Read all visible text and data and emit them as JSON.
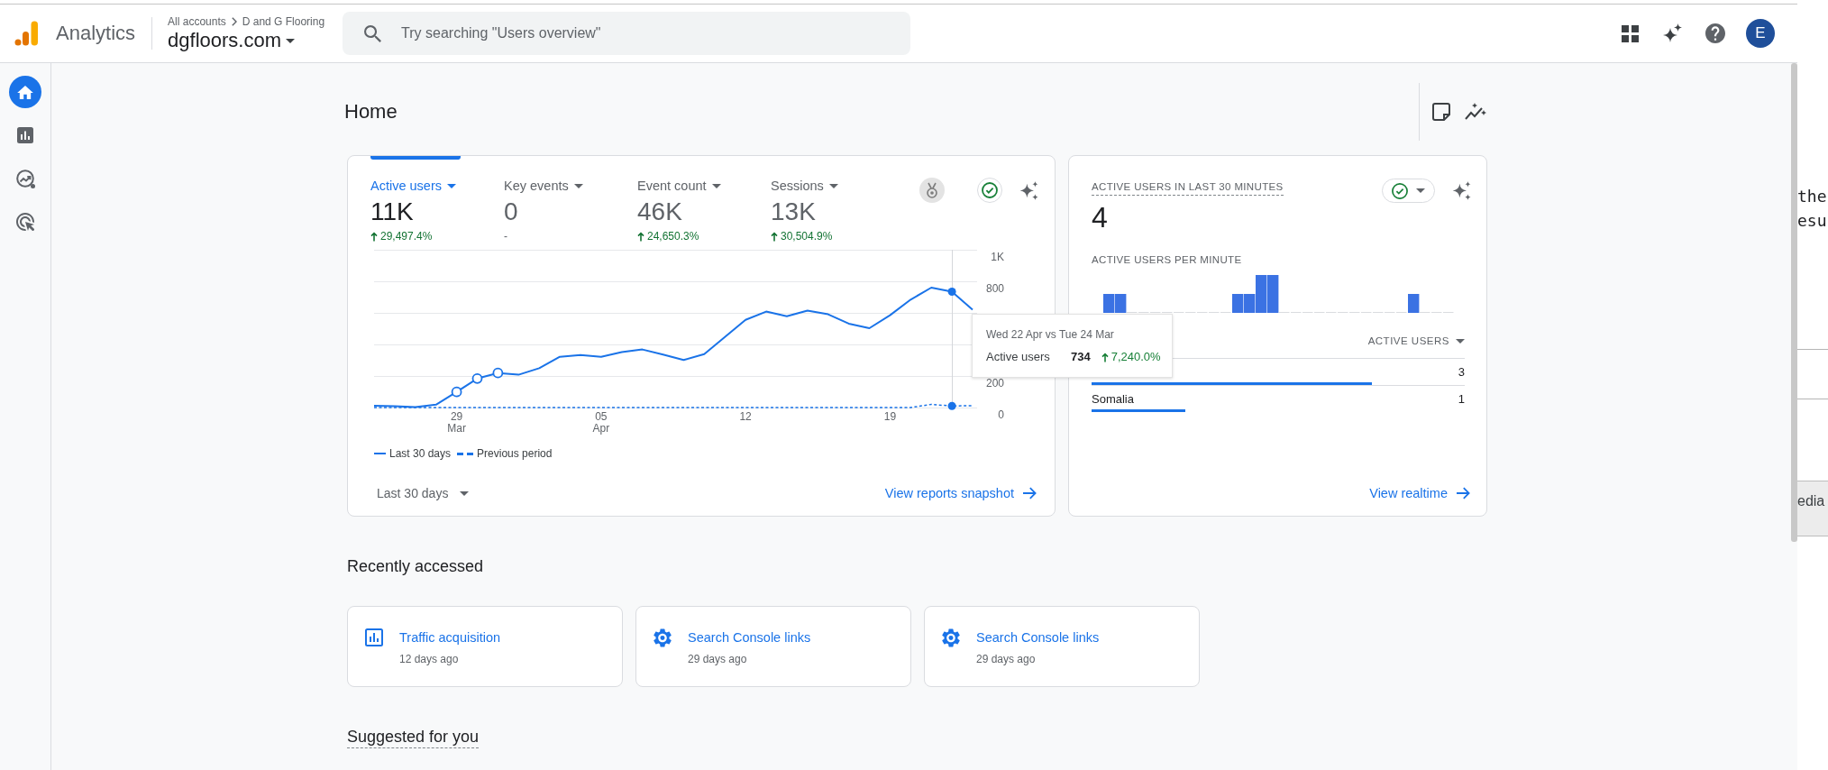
{
  "app_bar": {
    "product": "Analytics",
    "breadcrumb": [
      "All accounts",
      "D and G Flooring"
    ],
    "property": "dgfloors.com",
    "search": {
      "placeholder": "Try searching \"Users overview\""
    },
    "avatar": "E"
  },
  "nav": [
    {
      "kind": "home",
      "selected": true
    },
    {
      "kind": "reports",
      "selected": false
    },
    {
      "kind": "explore",
      "selected": false
    },
    {
      "kind": "advertising",
      "selected": false
    }
  ],
  "page": {
    "title": "Home"
  },
  "summary": {
    "metrics": [
      {
        "label": "Active users",
        "value": "11K",
        "change": "29,497.4%",
        "increase": true,
        "selected": true
      },
      {
        "label": "Key events",
        "value": "0",
        "change": "-",
        "increase": false,
        "selected": false
      },
      {
        "label": "Event count",
        "value": "46K",
        "change": "24,650.3%",
        "increase": true,
        "selected": false
      },
      {
        "label": "Sessions",
        "value": "13K",
        "change": "30,504.9%",
        "increase": true,
        "selected": false
      }
    ],
    "chart_data": {
      "type": "line",
      "categories": [
        null,
        null,
        null,
        null,
        "29\nMar",
        null,
        null,
        null,
        null,
        null,
        null,
        "05\nApr",
        null,
        null,
        null,
        null,
        null,
        null,
        "12",
        null,
        null,
        null,
        null,
        null,
        null,
        "19",
        null,
        null,
        null,
        null
      ],
      "ylim": [
        0,
        1000
      ],
      "yticks": [
        0,
        200,
        800,
        {
          "value": 1000,
          "label": "1K"
        }
      ],
      "series": [
        {
          "name": "Last 30 days",
          "color": "#1a73e8",
          "line_style": "solid",
          "values": [
            12,
            9,
            3,
            18,
            99,
            184,
            219,
            208,
            249,
            322,
            333,
            322,
            351,
            368,
            336,
            301,
            339,
            447,
            556,
            608,
            579,
            614,
            591,
            532,
            503,
            585,
            684,
            760,
            734,
            620
          ]
        },
        {
          "name": "Previous period",
          "color": "#1a73e8",
          "line_style": "dashed",
          "values": [
            0,
            0,
            0,
            0,
            0,
            0,
            0,
            0,
            0,
            0,
            0,
            0,
            0,
            0,
            0,
            0,
            0,
            0,
            0,
            0,
            0,
            0,
            0,
            0,
            0,
            0,
            0,
            20,
            10,
            12
          ]
        }
      ]
    },
    "tooltip": {
      "title": "Wed 22 Apr vs Tue 24 Mar",
      "label": "Active users",
      "value": "734",
      "change": "7,240.0%",
      "increase": true
    },
    "date_range": "Last 30 days",
    "link": "View reports snapshot"
  },
  "realtime": {
    "title": "ACTIVE USERS IN LAST 30 MINUTES",
    "value": "4",
    "subtitle": "ACTIVE USERS PER MINUTE",
    "column": "ACTIVE USERS",
    "rows": [
      {
        "value": "3",
        "level": 0.75
      },
      {
        "country": "Somalia",
        "value": "1",
        "level": 0.25
      }
    ],
    "link": "View realtime"
  },
  "recently_accessed": {
    "title": "Recently accessed",
    "items": [
      {
        "kind": "report",
        "title": "Traffic acquisition",
        "time": "12 days ago"
      },
      {
        "kind": "settings",
        "title": "Search Console links",
        "time": "29 days ago"
      },
      {
        "kind": "settings",
        "title": "Search Console links",
        "time": "29 days ago"
      }
    ]
  },
  "suggested": {
    "title": "Suggested for you"
  },
  "background_window": {
    "lines": [
      "the",
      "esu"
    ],
    "tab": "edia"
  }
}
